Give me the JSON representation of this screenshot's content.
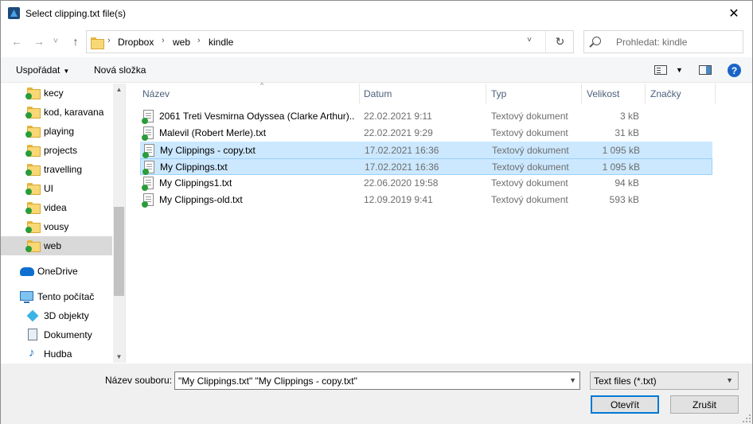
{
  "window": {
    "title": "Select clipping.txt file(s)",
    "close_glyph": "✕"
  },
  "nav": {
    "back_glyph": "←",
    "forward_glyph": "→",
    "recent_glyph": "˅",
    "up_glyph": "↑",
    "breadcrumb": [
      "Dropbox",
      "web",
      "kindle"
    ],
    "separator": "›",
    "dropdown_glyph": "˅",
    "refresh_glyph": "↻",
    "search_placeholder": "Prohledat: kindle"
  },
  "toolbar": {
    "organize_label": "Uspořádat",
    "new_folder_label": "Nová složka",
    "help_label": "?"
  },
  "sidebar": {
    "items": [
      {
        "label": "kecy",
        "icon": "folder-icon"
      },
      {
        "label": "kod, karavana",
        "icon": "folder-icon"
      },
      {
        "label": "playing",
        "icon": "folder-icon"
      },
      {
        "label": "projects",
        "icon": "folder-icon"
      },
      {
        "label": "travelling",
        "icon": "folder-icon"
      },
      {
        "label": "UI",
        "icon": "folder-icon"
      },
      {
        "label": "videa",
        "icon": "folder-icon"
      },
      {
        "label": "vousy",
        "icon": "folder-icon"
      },
      {
        "label": "web",
        "icon": "folder-icon",
        "selected": true
      },
      {
        "label": "OneDrive",
        "icon": "onedrive-icon"
      },
      {
        "label": "Tento počítač",
        "icon": "computer-icon"
      },
      {
        "label": "3D objekty",
        "icon": "3d-objects-icon"
      },
      {
        "label": "Dokumenty",
        "icon": "documents-icon"
      },
      {
        "label": "Hudba",
        "icon": "music-icon"
      }
    ]
  },
  "columns": {
    "name": "Název",
    "date": "Datum",
    "type": "Typ",
    "size": "Velikost",
    "tags": "Značky"
  },
  "files": [
    {
      "name": "2061 Treti Vesmirna Odyssea (Clarke Arthur)....",
      "date": "22.02.2021 9:11",
      "type": "Textový dokument",
      "size": "3 kB",
      "state": "none"
    },
    {
      "name": "Malevil (Robert Merle).txt",
      "date": "22.02.2021 9:29",
      "type": "Textový dokument",
      "size": "31 kB",
      "state": "none"
    },
    {
      "name": "My Clippings - copy.txt",
      "date": "17.02.2021 16:36",
      "type": "Textový dokument",
      "size": "1 095 kB",
      "state": "selected"
    },
    {
      "name": "My Clippings.txt",
      "date": "17.02.2021 16:36",
      "type": "Textový dokument",
      "size": "1 095 kB",
      "state": "focused"
    },
    {
      "name": "My Clippings1.txt",
      "date": "22.06.2020 19:58",
      "type": "Textový dokument",
      "size": "94 kB",
      "state": "none"
    },
    {
      "name": "My Clippings-old.txt",
      "date": "12.09.2019 9:41",
      "type": "Textový dokument",
      "size": "593 kB",
      "state": "none"
    }
  ],
  "footer": {
    "filename_label": "Název souboru:",
    "filename_value": "\"My Clippings.txt\" \"My Clippings - copy.txt\"",
    "filter_value": "Text files (*.txt)",
    "open_label": "Otevřít",
    "cancel_label": "Zrušit"
  }
}
